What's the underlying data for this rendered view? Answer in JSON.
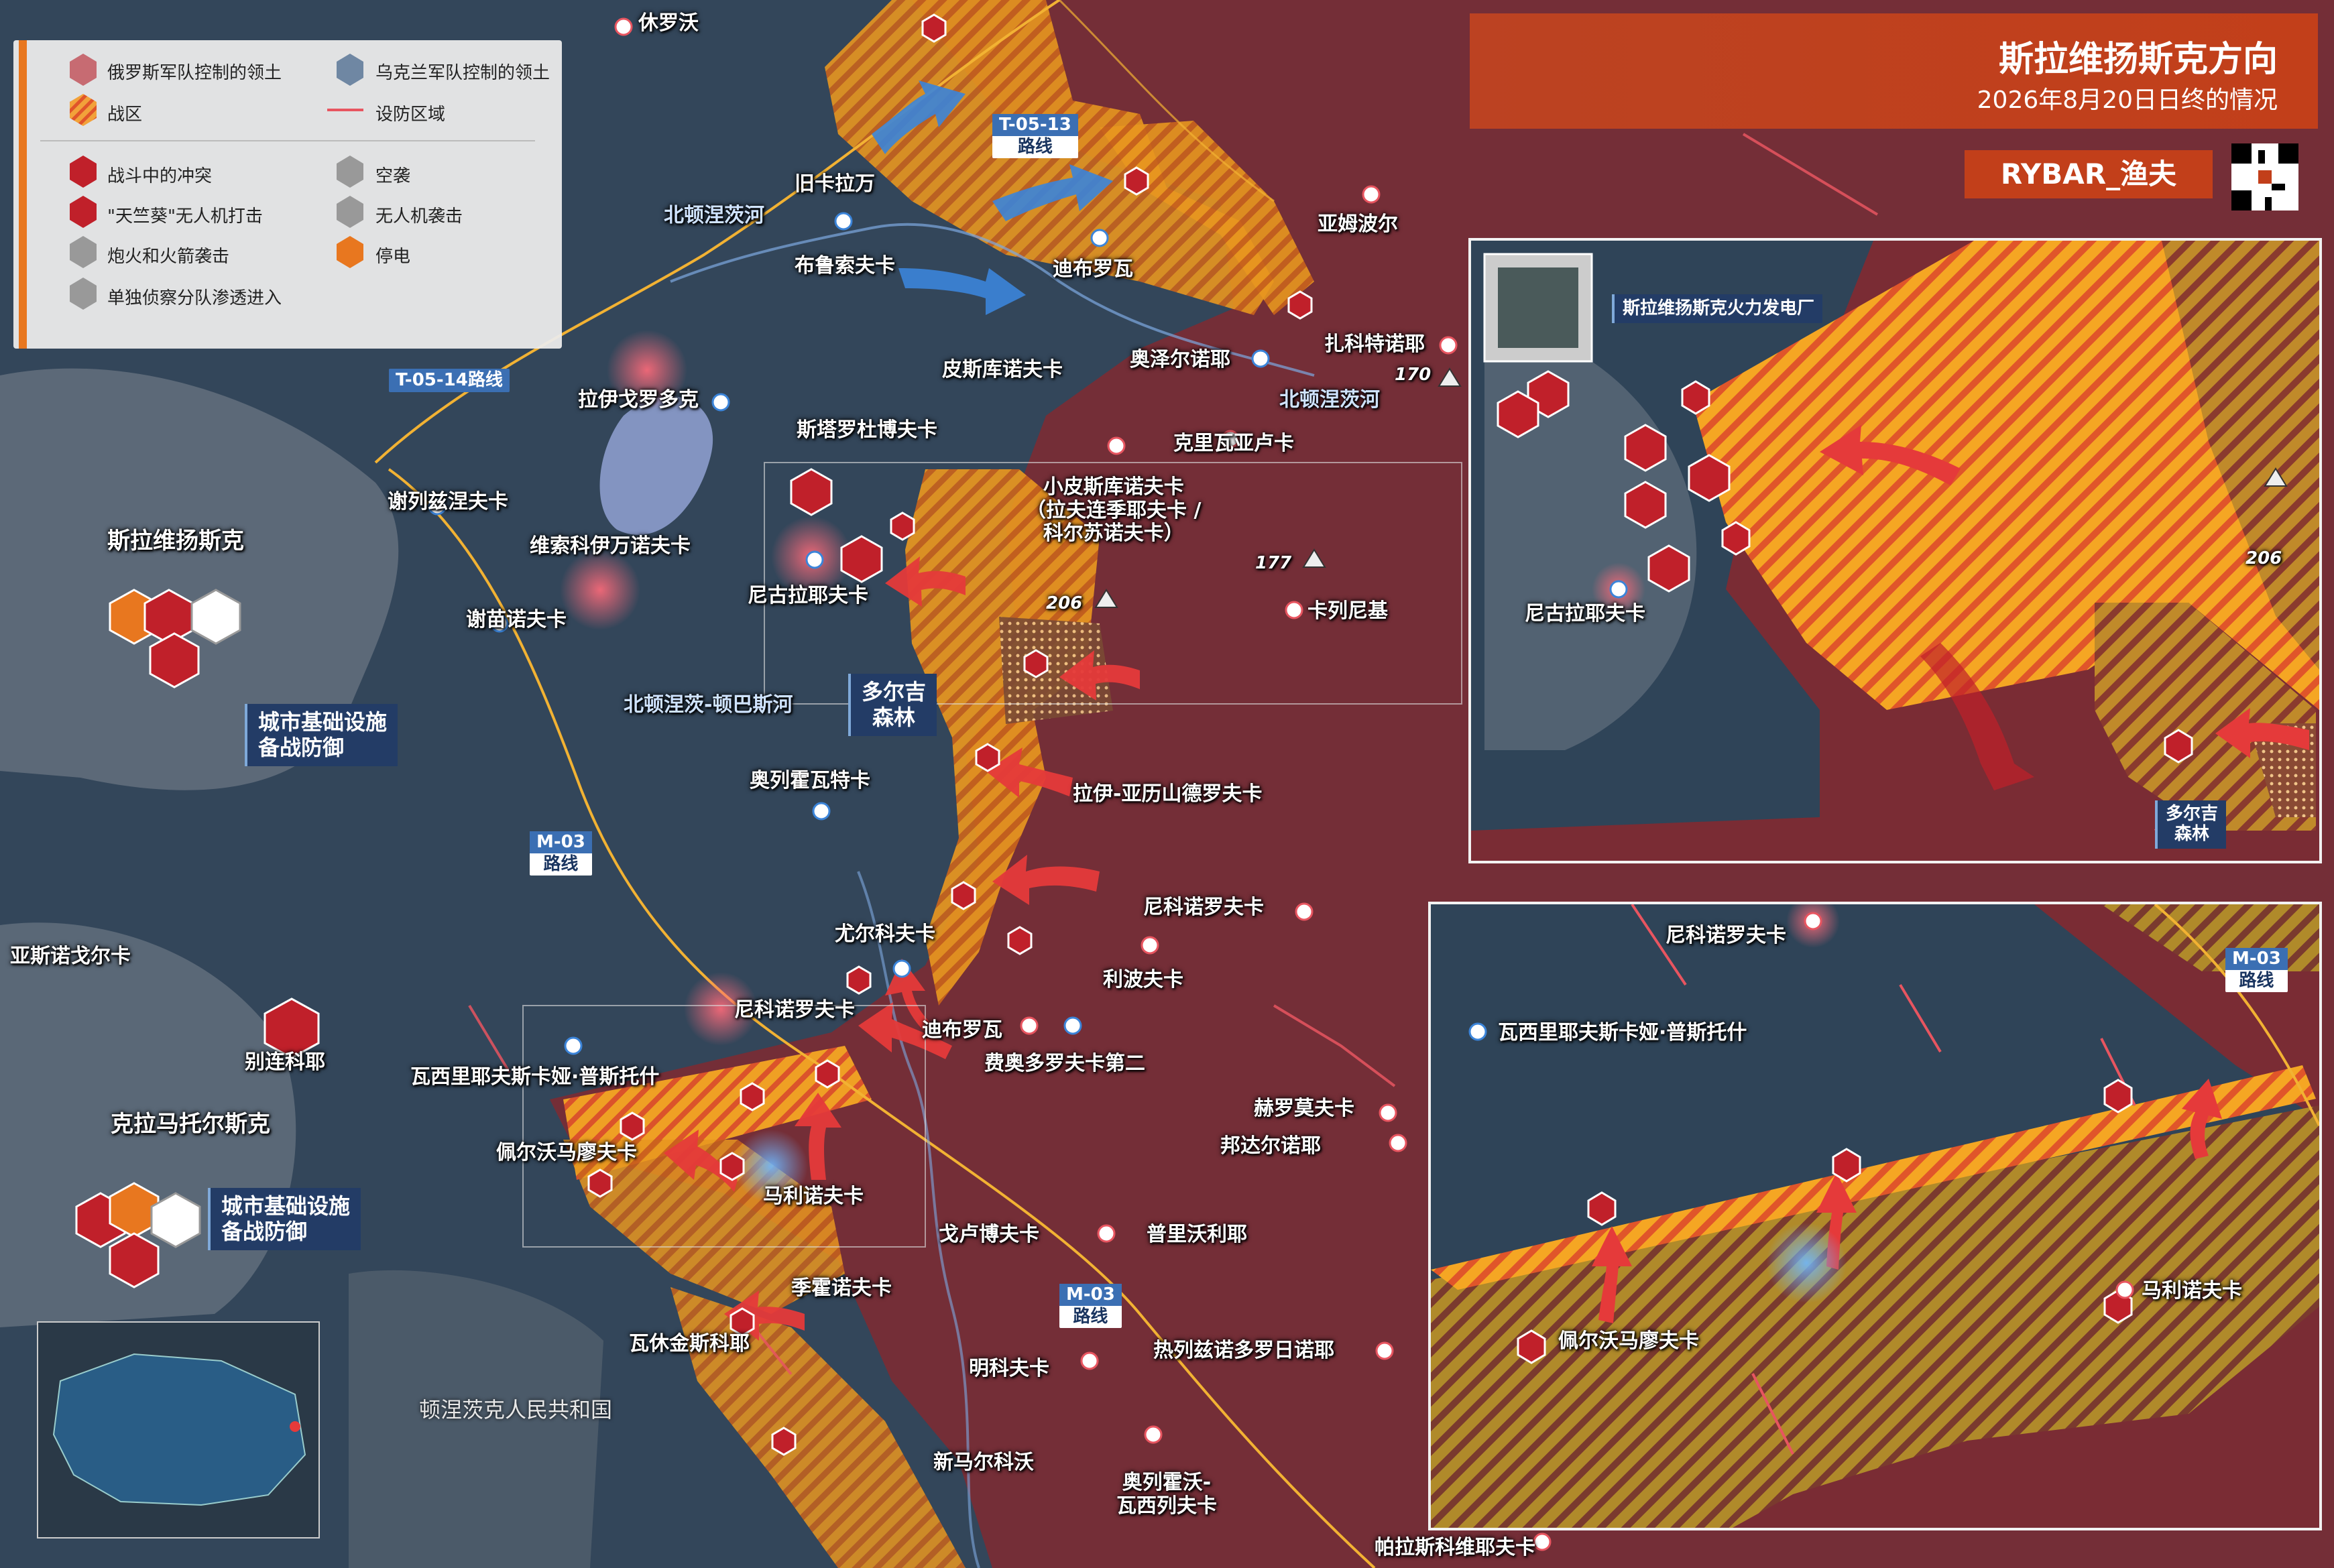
{
  "header": {
    "title": "斯拉维扬斯克方向",
    "subtitle": "2026年8月20日日终的情况",
    "brand": "RYBAR_渔夫"
  },
  "legend": {
    "items": [
      {
        "label": "俄罗斯军队控制的领土"
      },
      {
        "label": "乌克兰军队控制的领土"
      },
      {
        "label": "战区"
      },
      {
        "label": "设防区域"
      },
      {
        "label": "战斗中的冲突"
      },
      {
        "label": "空袭"
      },
      {
        "label": "\"天竺葵\"无人机打击"
      },
      {
        "label": "无人机袭击"
      },
      {
        "label": "炮火和火箭袭击"
      },
      {
        "label": "停电"
      },
      {
        "label": "单独侦察分队渗透进入"
      }
    ]
  },
  "colors": {
    "russian_territory": "#7a2c34",
    "ukrainian_territory": "#2f4a63",
    "combat_zone": "#e8961f",
    "fortified_line": "#e85560",
    "accent": "#c23f1a",
    "road": "#f2b233"
  },
  "roads": {
    "t0513": {
      "code": "T-05-13",
      "word": "路线"
    },
    "t0514": {
      "label": "T-05-14路线"
    },
    "m03a": {
      "code": "M-03",
      "word": "路线"
    },
    "m03b": {
      "code": "M-03",
      "word": "路线"
    },
    "m03inset": {
      "code": "M-03",
      "word": "路线"
    }
  },
  "places": {
    "khirovo": "休罗沃",
    "stary_karavan": "旧卡拉万",
    "brusovka": "布鲁索夫卡",
    "dibrova1": "迪布罗瓦",
    "ampolye": "亚姆波尔",
    "pyskunovka": "皮斯库诺夫卡",
    "ozerne": "奥泽尔诺耶",
    "zakotnoe": "扎科特诺耶",
    "raygorodok": "拉伊戈罗多克",
    "starobogorodka": "斯塔罗杜博夫卡",
    "krivaya_luka": "克里瓦亚卢卡",
    "serebryanka": "谢列兹涅夫卡",
    "malye_pyskunovka": "小皮斯库诺夫卡\n（拉夫连季耶夫卡 /\n科尔苏诺夫卡）",
    "vysokoivanovka": "维索科伊万诺夫卡",
    "nikolaevka1": "尼古拉耶夫卡",
    "semenovka": "谢苗诺夫卡",
    "karlovka": "卡列尼基",
    "slavyansk": "斯拉维扬斯克",
    "orlovka": "奥列霍瓦特卡",
    "ray_aleksandrovka": "拉伊-亚历山德罗夫卡",
    "nikonorovka_ne": "尼科诺罗夫卡",
    "yurkovka": "尤尔科夫卡",
    "libovka": "利波夫卡",
    "yasnogorka": "亚斯诺戈尔卡",
    "nikonorovka": "尼科诺罗夫卡",
    "dibrova2": "迪布罗瓦",
    "fedorovka2": "费奥多罗夫卡第二",
    "bilenkoe": "别连科耶",
    "vasilyevka": "瓦西里耶夫斯卡娅·普斯托什",
    "khromovka": "赫罗莫夫卡",
    "kramatorsk": "克拉马托尔斯克",
    "pervomaiskoe": "佩尔沃马廖夫卡",
    "bondarnoe": "邦达尔诺耶",
    "malinovka": "马利诺夫卡",
    "golubovka": "戈卢博夫卡",
    "privolye": "普里沃利耶",
    "sofievka": "季霍诺夫卡",
    "vasyukovka": "瓦休金斯科耶",
    "minkovka": "明科夫卡",
    "zheleznodorozhnoe": "热列兹诺多罗日诺耶",
    "novomarkovo": "新马尔科沃",
    "orekhovo_vasilyevka": "奥列霍沃-\n瓦西列夫卡",
    "paraskoviivka": "帕拉斯科维耶夫卡",
    "dpr": "顿涅茨克人民共和国"
  },
  "rivers": {
    "seversky_donets_w": "北顿涅茨河",
    "seversky_donets_e": "北顿涅茨河",
    "sd_donbass_canal": "北顿涅茨-顿巴斯河"
  },
  "heights": {
    "h170": "170",
    "h177": "177",
    "h206": "206",
    "h206b": "206"
  },
  "callouts": {
    "slavyansk_def": "城市基础设施\n备战防御",
    "kramatorsk_def": "城市基础设施\n备战防御",
    "dolgiy_forest": "多尔吉\n森林"
  },
  "inset1": {
    "power_plant": "斯拉维扬斯克火力发电厂",
    "nikolaevka": "尼古拉耶夫卡",
    "height": "206",
    "dolgiy": "多尔吉\n森林"
  },
  "inset2": {
    "nikonorovka": "尼科诺罗夫卡",
    "vasilyevka": "瓦西里耶夫斯卡娅·普斯托什",
    "pervomaiskoe": "佩尔沃马廖夫卡",
    "malinovka": "马利诺夫卡"
  }
}
